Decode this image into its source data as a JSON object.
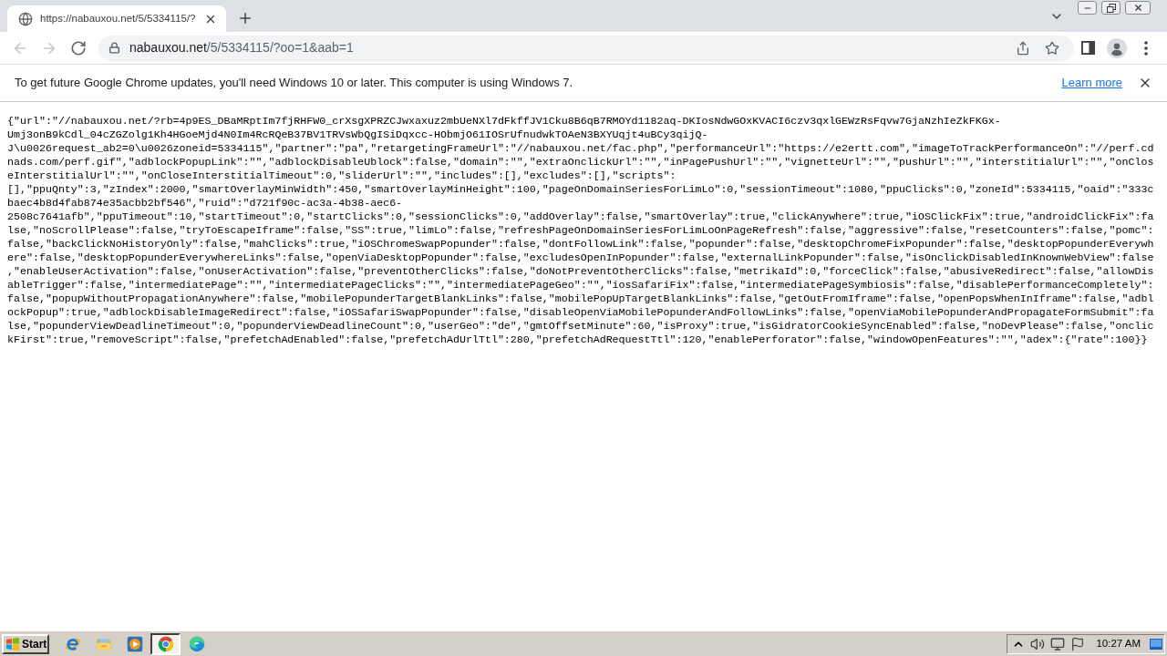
{
  "tab_strip": {
    "tabs": [
      {
        "title": "https://nabauxou.net/5/5334115/?",
        "selected": true
      }
    ]
  },
  "toolbar": {
    "nav_buttons": [
      {
        "kind": "back",
        "disabled": true
      },
      {
        "kind": "forward",
        "disabled": true
      },
      {
        "kind": "reload",
        "disabled": false
      }
    ],
    "address": {
      "host": "nabauxou.net",
      "path": "/5/5334115/?oo=1&aab=1"
    }
  },
  "info_bar": {
    "message": "To get future Google Chrome updates, you'll need Windows 10 or later. This computer is using Windows 7.",
    "link": "Learn more"
  },
  "page": {
    "lines": [
      "{\"url\":\"//nabauxou.net/?rb=4p9ES_DBaMRptIm7fjRHFW0_crXsgXPRZCJwxaxuz2mbUeNXl7dFkffJV1Cku8B6qB7RMOYd1182aq-DKIosNdwGOxKVACI6czv3qxlGEWzRsFqvw7GjaNzhIeZkFKGx-",
      "Umj3onB9kCdl_04cZGZolg1Kh4HGoeMjd4N0Im4RcRQeB37BV1TRVsWbQgISiDqxcc-HObmjO61IOSrUfnudwkTOAeN3BXYUqjt4uBCy3qijQ-",
      "J\\u0026request_ab2=0\\u0026zoneid=5334115\",\"partner\":\"pa\",\"retargetingFrameUrl\":\"//nabauxou.net/fac.php\",\"performanceUrl\":\"https://e2ertt.com\",\"imageToTrackPerformanceOn\":\"//perf.cd",
      "nads.com/perf.gif\",\"adblockPopupLink\":\"\",\"adblockDisableUblock\":false,\"domain\":\"\",\"extraOnclickUrl\":\"\",\"inPagePushUrl\":\"\",\"vignetteUrl\":\"\",\"pushUrl\":\"\",\"interstitialUrl\":\"\",\"onClos",
      "eInterstitialUrl\":\"\",\"onCloseInterstitialTimeout\":0,\"sliderUrl\":\"\",\"includes\":[],\"excludes\":[],\"scripts\":",
      "[],\"ppuQnty\":3,\"zIndex\":2000,\"smartOverlayMinWidth\":450,\"smartOverlayMinHeight\":100,\"pageOnDomainSeriesForLimLo\":0,\"sessionTimeout\":1080,\"ppuClicks\":0,\"zoneId\":5334115,\"oaid\":\"333c",
      "baec4b8d4fab874e35acbb2bf546\",\"ruid\":\"d721f90c-ac3a-4b38-aec6-",
      "2508c7641afb\",\"ppuTimeout\":10,\"startTimeout\":0,\"startClicks\":0,\"sessionClicks\":0,\"addOverlay\":false,\"smartOverlay\":true,\"clickAnywhere\":true,\"iOSClickFix\":true,\"androidClickFix\":fa",
      "lse,\"noScrollPlease\":false,\"tryToEscapeIframe\":false,\"SS\":true,\"limLo\":false,\"refreshPageOnDomainSeriesForLimLoOnPageRefresh\":false,\"aggressive\":false,\"resetCounters\":false,\"pomc\":",
      "false,\"backClickNoHistoryOnly\":false,\"mahClicks\":true,\"iOSChromeSwapPopunder\":false,\"dontFollowLink\":false,\"popunder\":false,\"desktopChromeFixPopunder\":false,\"desktopPopunderEverywh",
      "ere\":false,\"desktopPopunderEverywhereLinks\":false,\"openViaDesktopPopunder\":false,\"excludesOpenInPopunder\":false,\"externalLinkPopunder\":false,\"isOnclickDisabledInKnownWebView\":false",
      ",\"enableUserActivation\":false,\"onUserActivation\":false,\"preventOtherClicks\":false,\"doNotPreventOtherClicks\":false,\"metrikaId\":0,\"forceClick\":false,\"abusiveRedirect\":false,\"allowDis",
      "ableTrigger\":false,\"intermediatePage\":\"\",\"intermediatePageClicks\":\"\",\"intermediatePageGeo\":\"\",\"iosSafariFix\":false,\"intermediatePageSymbiosis\":false,\"disablePerformanceCompletely\":",
      "false,\"popupWithoutPropagationAnywhere\":false,\"mobilePopunderTargetBlankLinks\":false,\"mobilePopUpTargetBlankLinks\":false,\"getOutFromIframe\":false,\"openPopsWhenInIframe\":false,\"adbl",
      "ockPopup\":true,\"adblockDisableImageRedirect\":false,\"iOSSafariSwapPopunder\":false,\"disableOpenViaMobilePopunderAndFollowLinks\":false,\"openViaMobilePopunderAndPropagateFormSubmit\":fa",
      "lse,\"popunderViewDeadlineTimeout\":0,\"popunderViewDeadlineCount\":0,\"userGeo\":\"de\",\"gmtOffsetMinute\":60,\"isProxy\":true,\"isGidratorCookieSyncEnabled\":false,\"noDevPlease\":false,\"onclic",
      "kFirst\":true,\"removeScript\":false,\"prefetchAdEnabled\":false,\"prefetchAdUrlTtl\":280,\"prefetchAdRequestTtl\":120,\"enablePerforator\":false,\"windowOpenFeatures\":\"\",\"adex\":{\"rate\":100}}"
    ]
  },
  "taskbar": {
    "start": "Start",
    "apps": [
      {
        "kind": "ie",
        "selected": false
      },
      {
        "kind": "folder",
        "selected": false
      },
      {
        "kind": "media",
        "selected": false
      },
      {
        "kind": "chrome",
        "selected": true
      },
      {
        "kind": "edge",
        "selected": false
      }
    ],
    "clock": "10:27 AM"
  }
}
